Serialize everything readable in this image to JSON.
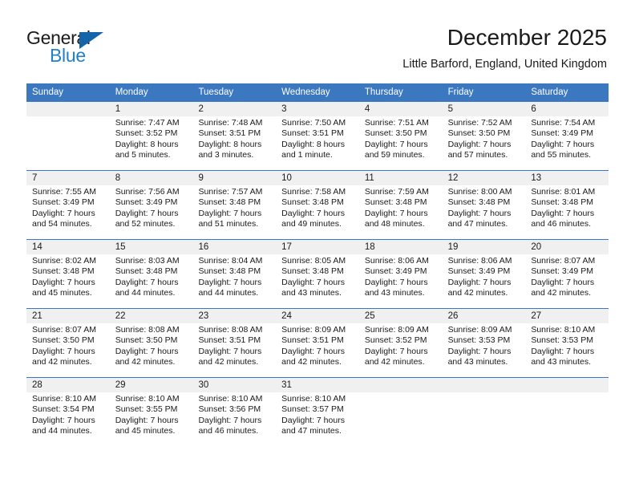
{
  "logo": {
    "word_top": "General",
    "word_bottom": "Blue",
    "triangle_color": "#1464aa",
    "blue_color": "#2180c8"
  },
  "header": {
    "title": "December 2025",
    "location": "Little Barford, England, United Kingdom"
  },
  "colors": {
    "header_blue": "#3b78bf",
    "daynum_band": "#f0f0f0"
  },
  "weekdays": [
    "Sunday",
    "Monday",
    "Tuesday",
    "Wednesday",
    "Thursday",
    "Friday",
    "Saturday"
  ],
  "weeks": [
    {
      "days": [
        {
          "num": "",
          "empty": true,
          "l1": "",
          "l2": "",
          "l3": "",
          "l4": ""
        },
        {
          "num": "1",
          "empty": false,
          "l1": "Sunrise: 7:47 AM",
          "l2": "Sunset: 3:52 PM",
          "l3": "Daylight: 8 hours",
          "l4": "and 5 minutes."
        },
        {
          "num": "2",
          "empty": false,
          "l1": "Sunrise: 7:48 AM",
          "l2": "Sunset: 3:51 PM",
          "l3": "Daylight: 8 hours",
          "l4": "and 3 minutes."
        },
        {
          "num": "3",
          "empty": false,
          "l1": "Sunrise: 7:50 AM",
          "l2": "Sunset: 3:51 PM",
          "l3": "Daylight: 8 hours",
          "l4": "and 1 minute."
        },
        {
          "num": "4",
          "empty": false,
          "l1": "Sunrise: 7:51 AM",
          "l2": "Sunset: 3:50 PM",
          "l3": "Daylight: 7 hours",
          "l4": "and 59 minutes."
        },
        {
          "num": "5",
          "empty": false,
          "l1": "Sunrise: 7:52 AM",
          "l2": "Sunset: 3:50 PM",
          "l3": "Daylight: 7 hours",
          "l4": "and 57 minutes."
        },
        {
          "num": "6",
          "empty": false,
          "l1": "Sunrise: 7:54 AM",
          "l2": "Sunset: 3:49 PM",
          "l3": "Daylight: 7 hours",
          "l4": "and 55 minutes."
        }
      ]
    },
    {
      "days": [
        {
          "num": "7",
          "empty": false,
          "l1": "Sunrise: 7:55 AM",
          "l2": "Sunset: 3:49 PM",
          "l3": "Daylight: 7 hours",
          "l4": "and 54 minutes."
        },
        {
          "num": "8",
          "empty": false,
          "l1": "Sunrise: 7:56 AM",
          "l2": "Sunset: 3:49 PM",
          "l3": "Daylight: 7 hours",
          "l4": "and 52 minutes."
        },
        {
          "num": "9",
          "empty": false,
          "l1": "Sunrise: 7:57 AM",
          "l2": "Sunset: 3:48 PM",
          "l3": "Daylight: 7 hours",
          "l4": "and 51 minutes."
        },
        {
          "num": "10",
          "empty": false,
          "l1": "Sunrise: 7:58 AM",
          "l2": "Sunset: 3:48 PM",
          "l3": "Daylight: 7 hours",
          "l4": "and 49 minutes."
        },
        {
          "num": "11",
          "empty": false,
          "l1": "Sunrise: 7:59 AM",
          "l2": "Sunset: 3:48 PM",
          "l3": "Daylight: 7 hours",
          "l4": "and 48 minutes."
        },
        {
          "num": "12",
          "empty": false,
          "l1": "Sunrise: 8:00 AM",
          "l2": "Sunset: 3:48 PM",
          "l3": "Daylight: 7 hours",
          "l4": "and 47 minutes."
        },
        {
          "num": "13",
          "empty": false,
          "l1": "Sunrise: 8:01 AM",
          "l2": "Sunset: 3:48 PM",
          "l3": "Daylight: 7 hours",
          "l4": "and 46 minutes."
        }
      ]
    },
    {
      "days": [
        {
          "num": "14",
          "empty": false,
          "l1": "Sunrise: 8:02 AM",
          "l2": "Sunset: 3:48 PM",
          "l3": "Daylight: 7 hours",
          "l4": "and 45 minutes."
        },
        {
          "num": "15",
          "empty": false,
          "l1": "Sunrise: 8:03 AM",
          "l2": "Sunset: 3:48 PM",
          "l3": "Daylight: 7 hours",
          "l4": "and 44 minutes."
        },
        {
          "num": "16",
          "empty": false,
          "l1": "Sunrise: 8:04 AM",
          "l2": "Sunset: 3:48 PM",
          "l3": "Daylight: 7 hours",
          "l4": "and 44 minutes."
        },
        {
          "num": "17",
          "empty": false,
          "l1": "Sunrise: 8:05 AM",
          "l2": "Sunset: 3:48 PM",
          "l3": "Daylight: 7 hours",
          "l4": "and 43 minutes."
        },
        {
          "num": "18",
          "empty": false,
          "l1": "Sunrise: 8:06 AM",
          "l2": "Sunset: 3:49 PM",
          "l3": "Daylight: 7 hours",
          "l4": "and 43 minutes."
        },
        {
          "num": "19",
          "empty": false,
          "l1": "Sunrise: 8:06 AM",
          "l2": "Sunset: 3:49 PM",
          "l3": "Daylight: 7 hours",
          "l4": "and 42 minutes."
        },
        {
          "num": "20",
          "empty": false,
          "l1": "Sunrise: 8:07 AM",
          "l2": "Sunset: 3:49 PM",
          "l3": "Daylight: 7 hours",
          "l4": "and 42 minutes."
        }
      ]
    },
    {
      "days": [
        {
          "num": "21",
          "empty": false,
          "l1": "Sunrise: 8:07 AM",
          "l2": "Sunset: 3:50 PM",
          "l3": "Daylight: 7 hours",
          "l4": "and 42 minutes."
        },
        {
          "num": "22",
          "empty": false,
          "l1": "Sunrise: 8:08 AM",
          "l2": "Sunset: 3:50 PM",
          "l3": "Daylight: 7 hours",
          "l4": "and 42 minutes."
        },
        {
          "num": "23",
          "empty": false,
          "l1": "Sunrise: 8:08 AM",
          "l2": "Sunset: 3:51 PM",
          "l3": "Daylight: 7 hours",
          "l4": "and 42 minutes."
        },
        {
          "num": "24",
          "empty": false,
          "l1": "Sunrise: 8:09 AM",
          "l2": "Sunset: 3:51 PM",
          "l3": "Daylight: 7 hours",
          "l4": "and 42 minutes."
        },
        {
          "num": "25",
          "empty": false,
          "l1": "Sunrise: 8:09 AM",
          "l2": "Sunset: 3:52 PM",
          "l3": "Daylight: 7 hours",
          "l4": "and 42 minutes."
        },
        {
          "num": "26",
          "empty": false,
          "l1": "Sunrise: 8:09 AM",
          "l2": "Sunset: 3:53 PM",
          "l3": "Daylight: 7 hours",
          "l4": "and 43 minutes."
        },
        {
          "num": "27",
          "empty": false,
          "l1": "Sunrise: 8:10 AM",
          "l2": "Sunset: 3:53 PM",
          "l3": "Daylight: 7 hours",
          "l4": "and 43 minutes."
        }
      ]
    },
    {
      "days": [
        {
          "num": "28",
          "empty": false,
          "l1": "Sunrise: 8:10 AM",
          "l2": "Sunset: 3:54 PM",
          "l3": "Daylight: 7 hours",
          "l4": "and 44 minutes."
        },
        {
          "num": "29",
          "empty": false,
          "l1": "Sunrise: 8:10 AM",
          "l2": "Sunset: 3:55 PM",
          "l3": "Daylight: 7 hours",
          "l4": "and 45 minutes."
        },
        {
          "num": "30",
          "empty": false,
          "l1": "Sunrise: 8:10 AM",
          "l2": "Sunset: 3:56 PM",
          "l3": "Daylight: 7 hours",
          "l4": "and 46 minutes."
        },
        {
          "num": "31",
          "empty": false,
          "l1": "Sunrise: 8:10 AM",
          "l2": "Sunset: 3:57 PM",
          "l3": "Daylight: 7 hours",
          "l4": "and 47 minutes."
        },
        {
          "num": "",
          "empty": true,
          "l1": "",
          "l2": "",
          "l3": "",
          "l4": ""
        },
        {
          "num": "",
          "empty": true,
          "l1": "",
          "l2": "",
          "l3": "",
          "l4": ""
        },
        {
          "num": "",
          "empty": true,
          "l1": "",
          "l2": "",
          "l3": "",
          "l4": ""
        }
      ]
    }
  ]
}
